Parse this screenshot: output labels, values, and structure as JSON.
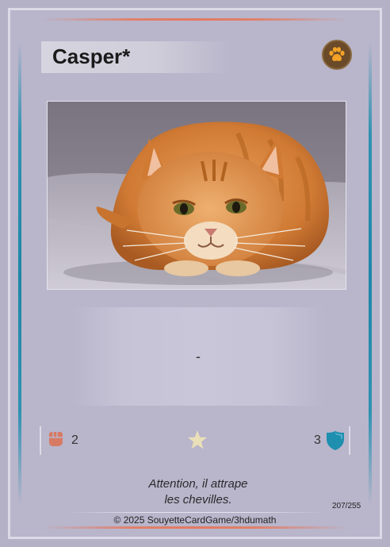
{
  "card": {
    "name": "Casper*",
    "type_icon": "paw-icon",
    "effect_text": "-",
    "attack": "2",
    "defense": "3",
    "rarity_icon": "star-icon",
    "flavor_line1": "Attention, il attrape",
    "flavor_line2": "les chevilles.",
    "number": "207/255",
    "copyright": "© 2025 SouyetteCardGame/3hdumath"
  },
  "colors": {
    "background": "#b9b5cb",
    "border_top_bottom": "#e27a62",
    "border_sides": "#1e86a8",
    "attack_icon": "#d77a64",
    "defense_icon": "#1f8fb0",
    "star": "#e9dfb8",
    "type_badge": "#6a4a28",
    "paw": "#f2a227"
  }
}
